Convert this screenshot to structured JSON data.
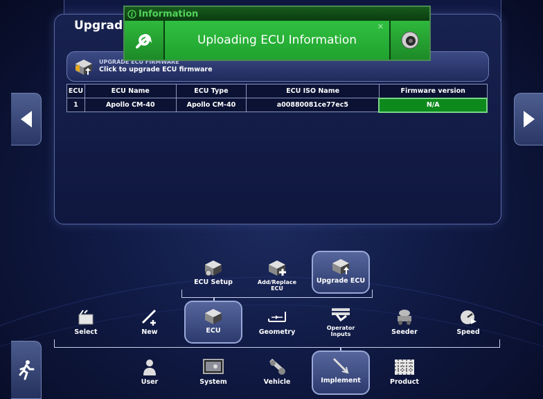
{
  "panel": {
    "title": "Upgrad",
    "upgrade_bar": {
      "heading": "UPGRADE ECU FIRMWARE",
      "subtitle": "Click to upgrade ECU firmware"
    },
    "table": {
      "columns": [
        "ECU",
        "ECU Name",
        "ECU Type",
        "ECU ISO Name",
        "Firmware version"
      ],
      "rows": [
        [
          "1",
          "Apollo CM-40",
          "Apollo CM-40",
          "a00880081ce77ec5",
          "N/A"
        ]
      ]
    }
  },
  "popup": {
    "title": "Information",
    "message": "Uploading ECU Information",
    "colors": {
      "body": "#20a22f",
      "title": "#52d45c"
    }
  },
  "submenu": [
    {
      "label": "ECU Setup",
      "icon": "ecu-setup-icon"
    },
    {
      "label": "Add/Replace ECU",
      "icon": "add-replace-ecu-icon"
    },
    {
      "label": "Upgrade ECU",
      "icon": "upgrade-ecu-icon",
      "selected": true
    }
  ],
  "implement_menu": [
    {
      "label": "Select",
      "icon": "select-icon"
    },
    {
      "label": "New",
      "icon": "new-icon"
    },
    {
      "label": "ECU",
      "icon": "ecu-icon",
      "selected": true
    },
    {
      "label": "Geometry",
      "icon": "geometry-icon"
    },
    {
      "label": "Operator Inputs",
      "icon": "operator-inputs-icon"
    },
    {
      "label": "Seeder",
      "icon": "seeder-icon"
    },
    {
      "label": "Speed",
      "icon": "speed-icon"
    }
  ],
  "main_menu": [
    {
      "label": "User",
      "icon": "user-icon"
    },
    {
      "label": "System",
      "icon": "system-icon"
    },
    {
      "label": "Vehicle",
      "icon": "vehicle-icon"
    },
    {
      "label": "Implement",
      "icon": "implement-icon",
      "selected": true
    },
    {
      "label": "Product",
      "icon": "product-icon"
    }
  ]
}
